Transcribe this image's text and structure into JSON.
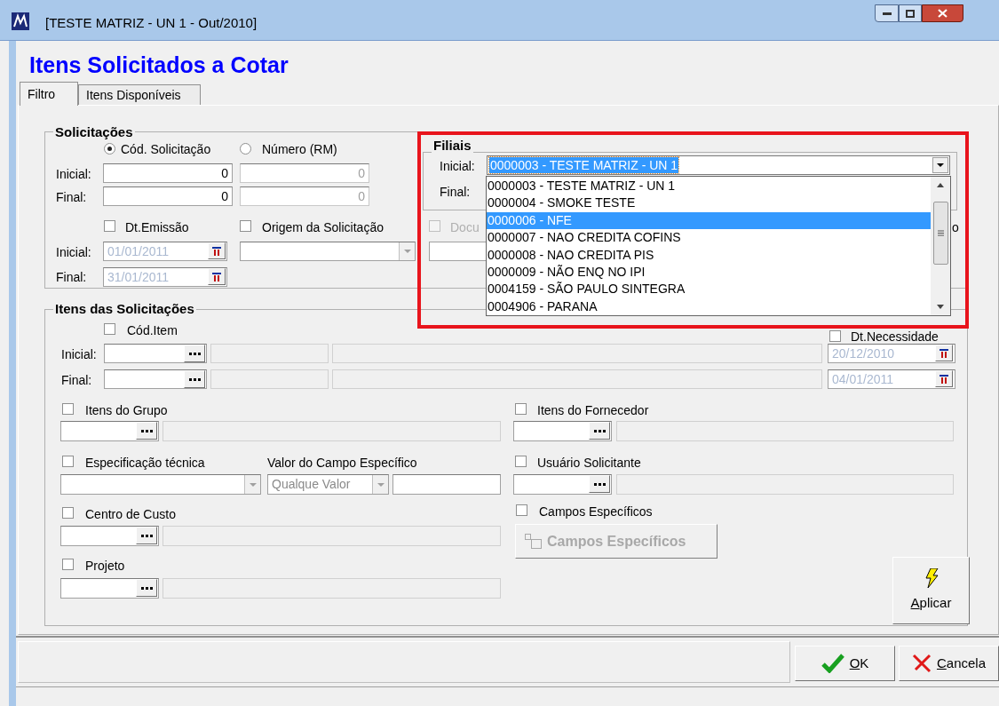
{
  "window": {
    "title": "[TESTE MATRIZ - UN 1 - Out/2010]"
  },
  "heading": "Itens Solicitados a Cotar",
  "tabs": [
    {
      "label": "Filtro",
      "selected": true
    },
    {
      "label": "Itens Disponíveis",
      "selected": false
    }
  ],
  "solicitacoes": {
    "title": "Solicitações",
    "radios": [
      {
        "label": "Cód. Solicitação",
        "selected": true
      },
      {
        "label": "Número (RM)",
        "selected": false
      }
    ],
    "rows": [
      {
        "label": "Inicial:",
        "code": "0",
        "number": "0"
      },
      {
        "label": "Final:",
        "code": "0",
        "number": "0"
      }
    ],
    "dt_emissao": {
      "label": "Dt.Emissão",
      "checked": false,
      "rows": [
        {
          "label": "Inicial:",
          "value": "01/01/2011"
        },
        {
          "label": "Final:",
          "value": "31/01/2011"
        }
      ]
    },
    "origem": {
      "label": "Origem da Solicitação",
      "checked": false
    },
    "docu": {
      "label": "Docu",
      "checked": false,
      "disabled": true
    },
    "partial_label": "o"
  },
  "filiais": {
    "title": "Filiais",
    "rows": [
      {
        "label": "Inicial:",
        "value": "0000003 - TESTE MATRIZ - UN 1"
      },
      {
        "label": "Final:"
      }
    ],
    "dropdown": [
      {
        "label": "0000003 - TESTE MATRIZ - UN 1",
        "selected": false
      },
      {
        "label": "0000004 - SMOKE TESTE",
        "selected": false
      },
      {
        "label": "0000006 - NFE",
        "selected": true
      },
      {
        "label": "0000007 - NAO CREDITA COFINS",
        "selected": false
      },
      {
        "label": "0000008 - NAO CREDITA PIS",
        "selected": false
      },
      {
        "label": "0000009 - NÃO ENQ NO IPI",
        "selected": false
      },
      {
        "label": "0004159 - SÃO PAULO SINTEGRA",
        "selected": false
      },
      {
        "label": "0004906 - PARANA",
        "selected": false
      }
    ]
  },
  "itens": {
    "title": "Itens das Solicitações",
    "cod_item": {
      "label": "Cód.Item",
      "checked": false,
      "rows": [
        {
          "label": "Inicial:"
        },
        {
          "label": "Final:"
        }
      ]
    },
    "dt_necessidade": {
      "label": "Dt.Necessidade",
      "checked": false,
      "dates": [
        "20/12/2010",
        "04/01/2011"
      ]
    },
    "left_lookups": [
      {
        "label": "Itens do Grupo",
        "checked": false
      }
    ],
    "especificacao": {
      "label": "Especificação técnica",
      "checked": false,
      "value_label": "Valor do Campo Específico",
      "value_combo": "Qualque Valor"
    },
    "lower_lookups": [
      {
        "label": "Centro de Custo",
        "checked": false
      },
      {
        "label": "Projeto",
        "checked": false
      }
    ],
    "right_lookups": [
      {
        "label": "Itens do Fornecedor",
        "checked": false
      },
      {
        "label": "Usuário Solicitante",
        "checked": false
      }
    ],
    "campos": {
      "label": "Campos Específicos",
      "checked": false,
      "button": "Campos Específicos",
      "disabled": true
    },
    "apply_button": "Aplicar"
  },
  "footer_buttons": [
    {
      "kind": "ok",
      "label": "OK"
    },
    {
      "kind": "cancel",
      "label": "Cancela"
    }
  ]
}
